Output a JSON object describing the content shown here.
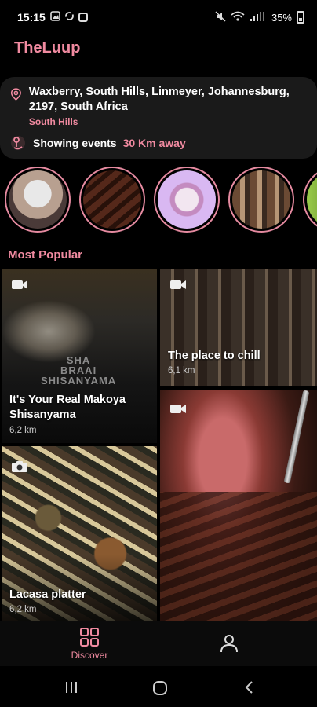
{
  "status_bar": {
    "time": "15:15",
    "battery": "35%",
    "icons": [
      "image-icon",
      "sync-icon",
      "checkbox-icon",
      "mute-icon",
      "wifi-icon",
      "signal-icon",
      "battery-icon"
    ]
  },
  "app": {
    "title": "TheLuup"
  },
  "location": {
    "address": "Waxberry, South Hills, Linmeyer, Johannesburg, 2197, South Africa",
    "suburb": "South Hills",
    "distance_label": "Showing events",
    "distance_value": "30 Km away"
  },
  "stories": [
    {
      "name": "story-group-photo"
    },
    {
      "name": "story-ribs"
    },
    {
      "name": "story-flower"
    },
    {
      "name": "story-steampunk"
    },
    {
      "name": "story-green"
    }
  ],
  "section": {
    "title": "Most Popular"
  },
  "tiles": [
    {
      "title": "It's Your Real Makoya Shisanyama",
      "distance": "6,2 km",
      "sign_line1": "SHA",
      "sign_line2": "BRAAI",
      "sign_line3": "SHISANYAMA"
    },
    {
      "title": "The place to chill",
      "distance": "6,1 km"
    },
    {
      "title": "",
      "distance": ""
    },
    {
      "title": "Lacasa platter",
      "distance": "6,2 km"
    }
  ],
  "bottom_nav": {
    "discover_label": "Discover"
  },
  "colors": {
    "accent": "#f08aa0",
    "background": "#000000",
    "card": "#1a1a1a"
  }
}
